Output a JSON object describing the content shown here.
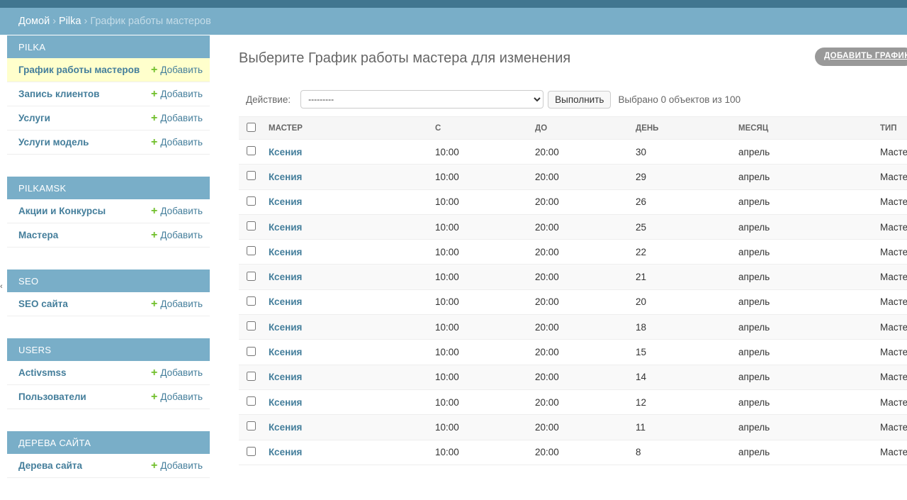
{
  "breadcrumbs": {
    "home": "Домой",
    "app": "Pilka",
    "current": "График работы мастеров",
    "separator": "›"
  },
  "sidebar": {
    "add_label": "Добавить",
    "modules": [
      {
        "caption": "PILKA",
        "items": [
          {
            "label": "График работы мастеров",
            "selected": true
          },
          {
            "label": "Запись клиентов"
          },
          {
            "label": "Услуги"
          },
          {
            "label": "Услуги модель"
          }
        ]
      },
      {
        "caption": "PILKAMSK",
        "items": [
          {
            "label": "Акции и Конкурсы"
          },
          {
            "label": "Мастера"
          }
        ]
      },
      {
        "caption": "SEO",
        "items": [
          {
            "label": "SEO сайта"
          }
        ]
      },
      {
        "caption": "USERS",
        "items": [
          {
            "label": "Activsmss"
          },
          {
            "label": "Пользователи"
          }
        ]
      },
      {
        "caption": "ДЕРЕВА САЙТА",
        "items": [
          {
            "label": "Дерева сайта"
          }
        ]
      }
    ]
  },
  "content": {
    "title": "Выберите График работы мастера для изменения",
    "add_button": "ДОБАВИТЬ ГРАФИК"
  },
  "actions": {
    "label": "Действие:",
    "selected_option": "---------",
    "run_button": "Выполнить",
    "counter": "Выбрано 0 объектов из 100"
  },
  "table": {
    "headers": [
      "МАСТЕР",
      "С",
      "ДО",
      "ДЕНЬ",
      "МЕСЯЦ",
      "ТИП"
    ],
    "rows": [
      [
        "Ксения",
        "10:00",
        "20:00",
        "30",
        "апрель",
        "Масте"
      ],
      [
        "Ксения",
        "10:00",
        "20:00",
        "29",
        "апрель",
        "Масте"
      ],
      [
        "Ксения",
        "10:00",
        "20:00",
        "26",
        "апрель",
        "Масте"
      ],
      [
        "Ксения",
        "10:00",
        "20:00",
        "25",
        "апрель",
        "Масте"
      ],
      [
        "Ксения",
        "10:00",
        "20:00",
        "22",
        "апрель",
        "Масте"
      ],
      [
        "Ксения",
        "10:00",
        "20:00",
        "21",
        "апрель",
        "Масте"
      ],
      [
        "Ксения",
        "10:00",
        "20:00",
        "20",
        "апрель",
        "Масте"
      ],
      [
        "Ксения",
        "10:00",
        "20:00",
        "18",
        "апрель",
        "Масте"
      ],
      [
        "Ксения",
        "10:00",
        "20:00",
        "15",
        "апрель",
        "Масте"
      ],
      [
        "Ксения",
        "10:00",
        "20:00",
        "14",
        "апрель",
        "Масте"
      ],
      [
        "Ксения",
        "10:00",
        "20:00",
        "12",
        "апрель",
        "Масте"
      ],
      [
        "Ксения",
        "10:00",
        "20:00",
        "11",
        "апрель",
        "Масте"
      ],
      [
        "Ксения",
        "10:00",
        "20:00",
        "8",
        "апрель",
        "Масте"
      ]
    ]
  },
  "colors": {
    "header_dark": "#417690",
    "header_light": "#79aec8",
    "link": "#447e9b",
    "add_plus": "#70bf2b",
    "selected_row": "#ffffcc"
  },
  "icons": {
    "add": "plus-icon",
    "edge": "chevron-left-icon"
  }
}
